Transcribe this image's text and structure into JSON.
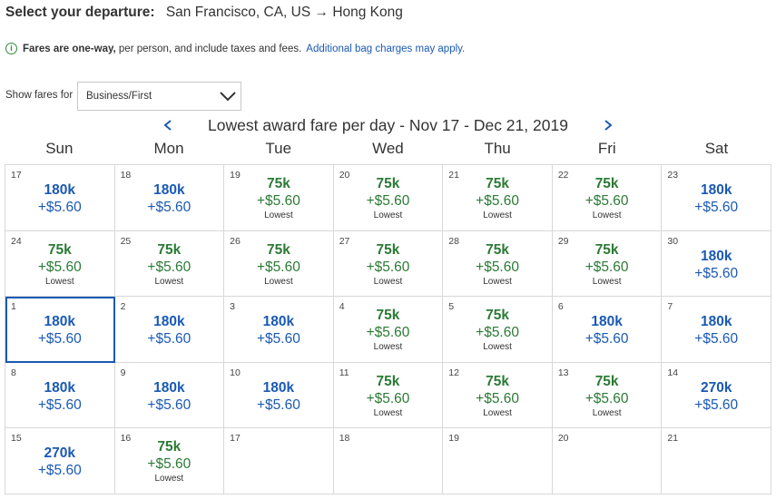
{
  "header": {
    "label": "Select your departure:",
    "route": "San Francisco, CA, US → Hong Kong"
  },
  "notice": {
    "icon": "info-icon",
    "bold_text": "Fares are one-way,",
    "text": "per person, and include taxes and fees.",
    "link_text": "Additional bag charges may apply."
  },
  "filter": {
    "label": "Show fares for",
    "selected": "Business/First"
  },
  "calendar": {
    "title": "Lowest award fare per day - Nov 17 - Dec 21, 2019",
    "weekdays": [
      "Sun",
      "Mon",
      "Tue",
      "Wed",
      "Thu",
      "Fri",
      "Sat"
    ],
    "lowest_label": "Lowest",
    "colors": {
      "standard": "#1a59b4",
      "lowest": "#2b7a35",
      "selected_border": "#1a59b4"
    },
    "days": [
      {
        "date": "17",
        "miles": "180k",
        "tax": "+$5.60",
        "lowest": false,
        "selected": false
      },
      {
        "date": "18",
        "miles": "180k",
        "tax": "+$5.60",
        "lowest": false,
        "selected": false
      },
      {
        "date": "19",
        "miles": "75k",
        "tax": "+$5.60",
        "lowest": true,
        "selected": false
      },
      {
        "date": "20",
        "miles": "75k",
        "tax": "+$5.60",
        "lowest": true,
        "selected": false
      },
      {
        "date": "21",
        "miles": "75k",
        "tax": "+$5.60",
        "lowest": true,
        "selected": false
      },
      {
        "date": "22",
        "miles": "75k",
        "tax": "+$5.60",
        "lowest": true,
        "selected": false
      },
      {
        "date": "23",
        "miles": "180k",
        "tax": "+$5.60",
        "lowest": false,
        "selected": false
      },
      {
        "date": "24",
        "miles": "75k",
        "tax": "+$5.60",
        "lowest": true,
        "selected": false
      },
      {
        "date": "25",
        "miles": "75k",
        "tax": "+$5.60",
        "lowest": true,
        "selected": false
      },
      {
        "date": "26",
        "miles": "75k",
        "tax": "+$5.60",
        "lowest": true,
        "selected": false
      },
      {
        "date": "27",
        "miles": "75k",
        "tax": "+$5.60",
        "lowest": true,
        "selected": false
      },
      {
        "date": "28",
        "miles": "75k",
        "tax": "+$5.60",
        "lowest": true,
        "selected": false
      },
      {
        "date": "29",
        "miles": "75k",
        "tax": "+$5.60",
        "lowest": true,
        "selected": false
      },
      {
        "date": "30",
        "miles": "180k",
        "tax": "+$5.60",
        "lowest": false,
        "selected": false
      },
      {
        "date": "1",
        "miles": "180k",
        "tax": "+$5.60",
        "lowest": false,
        "selected": true
      },
      {
        "date": "2",
        "miles": "180k",
        "tax": "+$5.60",
        "lowest": false,
        "selected": false
      },
      {
        "date": "3",
        "miles": "180k",
        "tax": "+$5.60",
        "lowest": false,
        "selected": false
      },
      {
        "date": "4",
        "miles": "75k",
        "tax": "+$5.60",
        "lowest": true,
        "selected": false
      },
      {
        "date": "5",
        "miles": "75k",
        "tax": "+$5.60",
        "lowest": true,
        "selected": false
      },
      {
        "date": "6",
        "miles": "180k",
        "tax": "+$5.60",
        "lowest": false,
        "selected": false
      },
      {
        "date": "7",
        "miles": "180k",
        "tax": "+$5.60",
        "lowest": false,
        "selected": false
      },
      {
        "date": "8",
        "miles": "180k",
        "tax": "+$5.60",
        "lowest": false,
        "selected": false
      },
      {
        "date": "9",
        "miles": "180k",
        "tax": "+$5.60",
        "lowest": false,
        "selected": false
      },
      {
        "date": "10",
        "miles": "180k",
        "tax": "+$5.60",
        "lowest": false,
        "selected": false
      },
      {
        "date": "11",
        "miles": "75k",
        "tax": "+$5.60",
        "lowest": true,
        "selected": false
      },
      {
        "date": "12",
        "miles": "75k",
        "tax": "+$5.60",
        "lowest": true,
        "selected": false
      },
      {
        "date": "13",
        "miles": "75k",
        "tax": "+$5.60",
        "lowest": true,
        "selected": false
      },
      {
        "date": "14",
        "miles": "270k",
        "tax": "+$5.60",
        "lowest": false,
        "selected": false
      },
      {
        "date": "15",
        "miles": "270k",
        "tax": "+$5.60",
        "lowest": false,
        "selected": false
      },
      {
        "date": "16",
        "miles": "75k",
        "tax": "+$5.60",
        "lowest": true,
        "selected": false
      },
      {
        "date": "17",
        "miles": "",
        "tax": "",
        "lowest": false,
        "selected": false
      },
      {
        "date": "18",
        "miles": "",
        "tax": "",
        "lowest": false,
        "selected": false
      },
      {
        "date": "19",
        "miles": "",
        "tax": "",
        "lowest": false,
        "selected": false
      },
      {
        "date": "20",
        "miles": "",
        "tax": "",
        "lowest": false,
        "selected": false
      },
      {
        "date": "21",
        "miles": "",
        "tax": "",
        "lowest": false,
        "selected": false
      }
    ]
  }
}
